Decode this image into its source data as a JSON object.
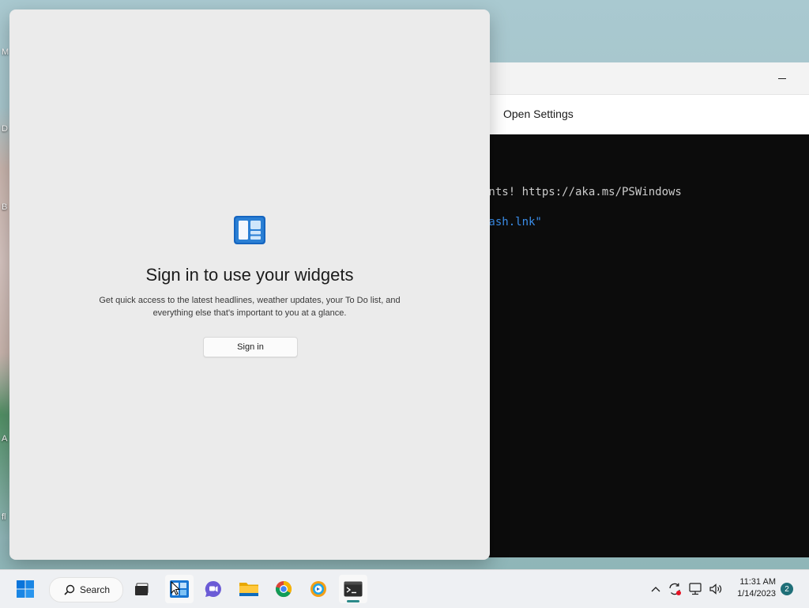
{
  "desktop": {
    "icon_labels": [
      "M",
      "D",
      "B",
      "A",
      "fl"
    ]
  },
  "terminal": {
    "minimize_symbol": "–",
    "infobar": {
      "open_settings": "Open Settings"
    },
    "lines": [
      "ents! https://aka.ms/PSWindows",
      "Dash.lnk\""
    ]
  },
  "widgets": {
    "icon": "widgets-icon",
    "title": "Sign in to use your widgets",
    "description": "Get quick access to the latest headlines, weather updates, your To Do list, and everything else that's important to you at a glance.",
    "signin_label": "Sign in"
  },
  "taskbar": {
    "search_label": "Search",
    "apps": [
      "start-icon",
      "search-icon",
      "task-view-icon",
      "widgets-icon",
      "teams-chat-icon",
      "file-explorer-icon",
      "chrome-icon",
      "browser-icon",
      "terminal-icon"
    ],
    "tray": {
      "time": "11:31 AM",
      "date": "1/14/2023",
      "notifications": "2"
    }
  },
  "colors": {
    "accent": "#0067c0",
    "terminal_bg": "#0c0c0c",
    "link": "#3b8eea",
    "widget_panel": "#ebebeb"
  }
}
